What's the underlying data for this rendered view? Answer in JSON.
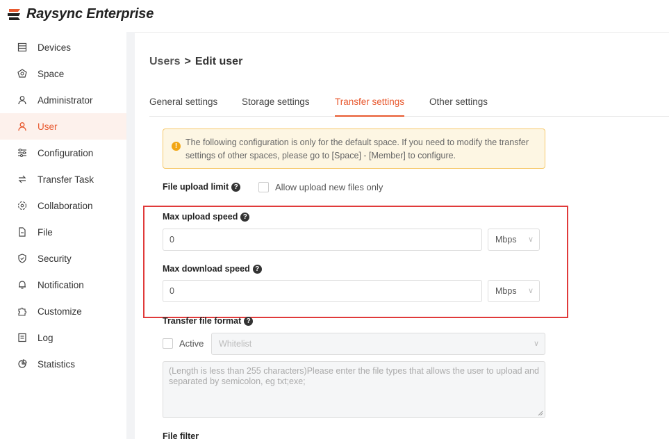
{
  "app": {
    "title": "Raysync Enterprise"
  },
  "sidebar": {
    "items": [
      {
        "label": "Devices",
        "icon": "devices-icon"
      },
      {
        "label": "Space",
        "icon": "space-icon"
      },
      {
        "label": "Administrator",
        "icon": "administrator-icon"
      },
      {
        "label": "User",
        "icon": "user-icon",
        "active": true
      },
      {
        "label": "Configuration",
        "icon": "configuration-icon"
      },
      {
        "label": "Transfer Task",
        "icon": "transfer-task-icon"
      },
      {
        "label": "Collaboration",
        "icon": "collaboration-icon"
      },
      {
        "label": "File",
        "icon": "file-icon"
      },
      {
        "label": "Security",
        "icon": "security-icon"
      },
      {
        "label": "Notification",
        "icon": "notification-icon"
      },
      {
        "label": "Customize",
        "icon": "customize-icon"
      },
      {
        "label": "Log",
        "icon": "log-icon"
      },
      {
        "label": "Statistics",
        "icon": "statistics-icon"
      }
    ]
  },
  "breadcrumb": {
    "root": "Users",
    "separator": ">",
    "current": "Edit user"
  },
  "tabs": [
    {
      "label": "General settings"
    },
    {
      "label": "Storage settings"
    },
    {
      "label": "Transfer settings",
      "active": true
    },
    {
      "label": "Other settings"
    }
  ],
  "notice": {
    "text": "The following configuration is only for the default space. If you need to modify the transfer settings of other spaces, please go to [Space] - [Member] to configure."
  },
  "form": {
    "upload_limit": {
      "label": "File upload limit",
      "checkbox_label": "Allow upload new files only"
    },
    "max_upload": {
      "label": "Max upload speed",
      "value": "0",
      "unit": "Mbps"
    },
    "max_download": {
      "label": "Max download speed",
      "value": "0",
      "unit": "Mbps"
    },
    "file_format": {
      "label": "Transfer file format",
      "active_label": "Active",
      "list_type": "Whitelist",
      "placeholder": "(Length is less than 255 characters)Please enter the file types that allows the user to upload and separated by semicolon, eg txt;exe;"
    },
    "file_filter": {
      "label": "File filter"
    }
  },
  "colors": {
    "accent": "#e8592f",
    "highlight_box": "#e03a3a",
    "notice_bg": "#fdf6e3",
    "notice_border": "#f6c96b"
  }
}
